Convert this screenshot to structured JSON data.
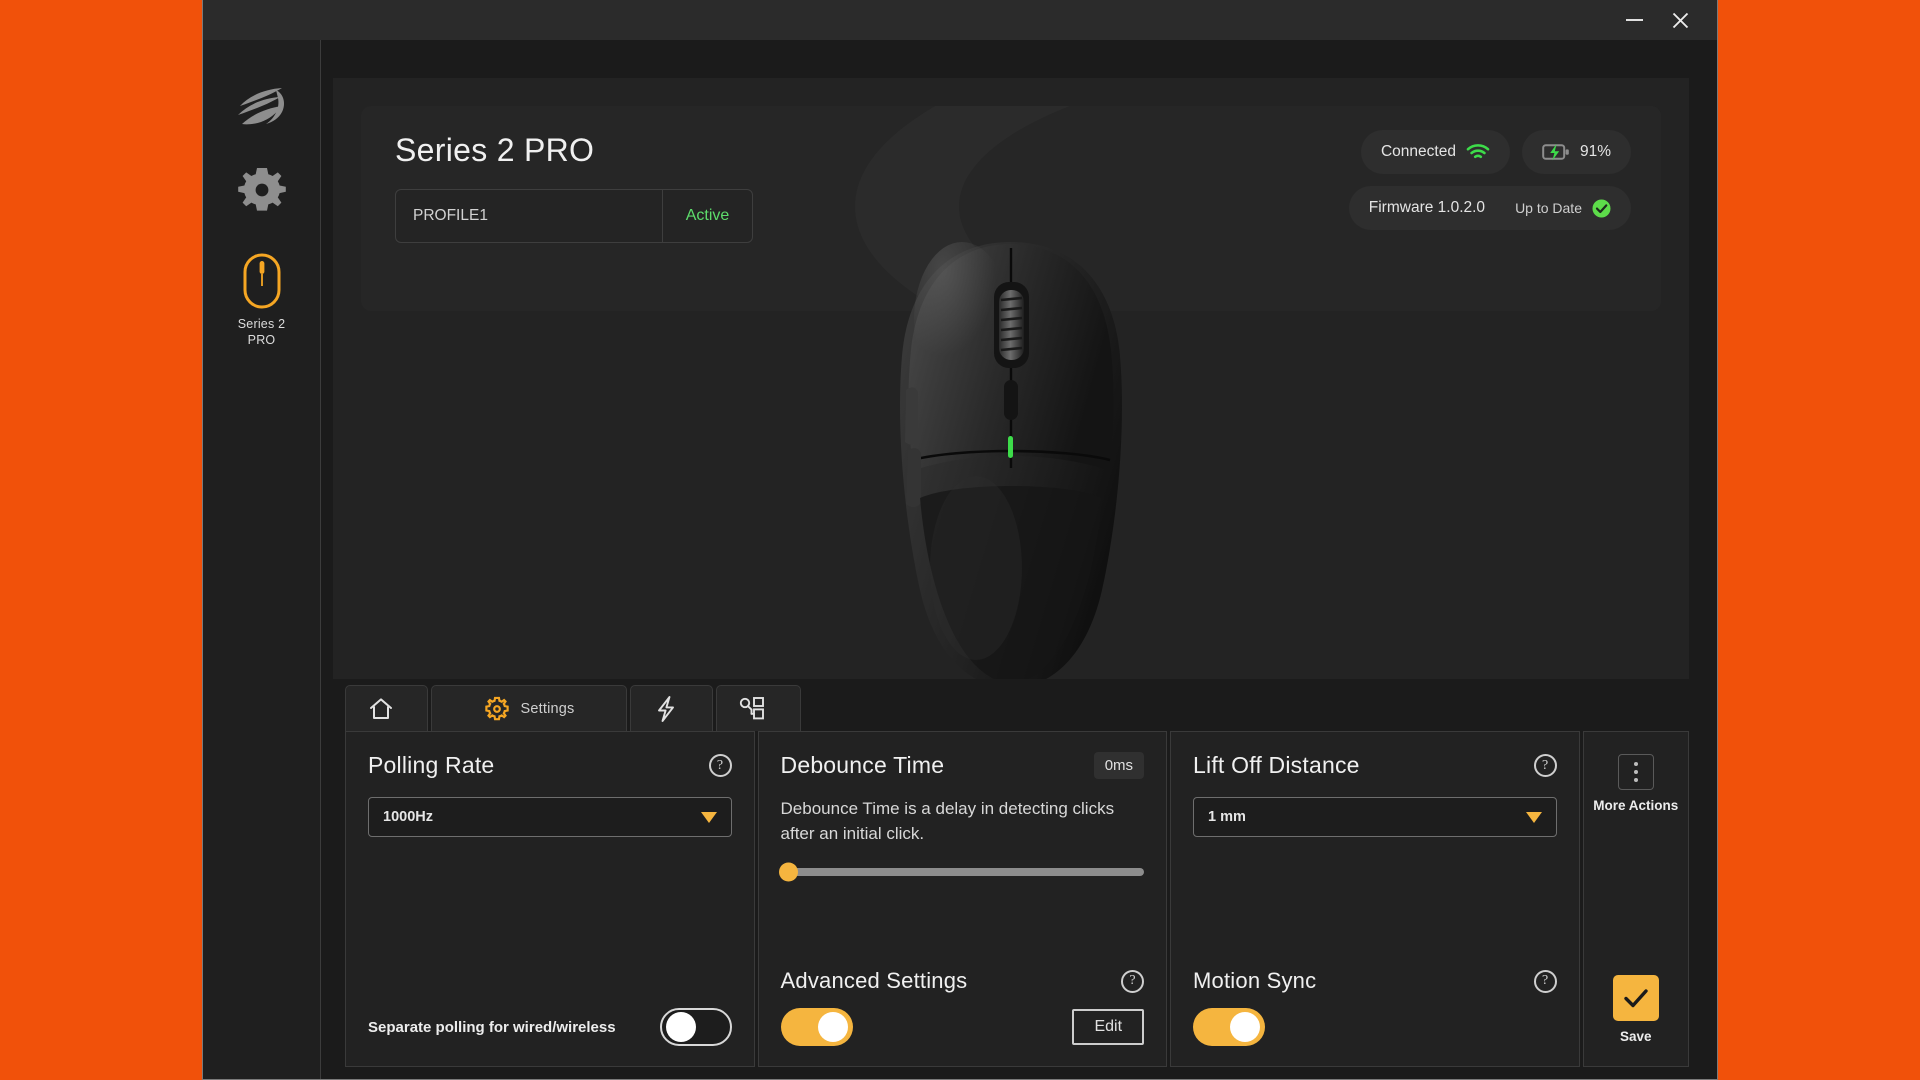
{
  "titlebar": {
    "minimize_label": "Minimize",
    "close_label": "Close"
  },
  "sidebar": {
    "items": [
      {
        "icon": "brand-logo-icon",
        "label": ""
      },
      {
        "icon": "gear-icon",
        "label": ""
      },
      {
        "icon": "mouse-icon",
        "label": "Series 2\nPRO",
        "label_line1": "Series 2",
        "label_line2": "PRO",
        "active": true
      }
    ]
  },
  "hero": {
    "device_title": "Series 2 PRO",
    "profile": {
      "name": "PROFILE1",
      "status": "Active"
    },
    "connection": {
      "label": "Connected",
      "icon": "wifi-icon",
      "color": "#3ddc4a"
    },
    "battery": {
      "value": "91%",
      "icon": "battery-charging-icon",
      "color": "#3ddc4a"
    },
    "firmware": {
      "label": "Firmware 1.0.2.0",
      "status": "Up to Date",
      "icon": "check-circle-icon",
      "color": "#5ddc4a"
    }
  },
  "tabs": [
    {
      "id": "home",
      "icon": "home-icon",
      "label": ""
    },
    {
      "id": "settings",
      "icon": "gear-icon",
      "label": "Settings",
      "active": true
    },
    {
      "id": "performance",
      "icon": "lightning-icon",
      "label": ""
    },
    {
      "id": "keybinds",
      "icon": "key-layout-icon",
      "label": ""
    }
  ],
  "panels": {
    "polling": {
      "title": "Polling Rate",
      "help_icon": "help-icon",
      "select_value": "1000Hz",
      "separate_polling_label": "Separate polling for wired/wireless",
      "separate_polling_state": "off"
    },
    "debounce": {
      "title": "Debounce Time",
      "value_chip": "0ms",
      "description": "Debounce Time is a delay in detecting clicks after an initial click.",
      "slider_percent": 0,
      "advanced": {
        "title": "Advanced Settings",
        "help_icon": "help-icon",
        "toggle_state": "on",
        "edit_label": "Edit"
      }
    },
    "lift_off": {
      "title": "Lift Off Distance",
      "help_icon": "help-icon",
      "select_value": "1 mm",
      "motion_sync": {
        "title": "Motion Sync",
        "help_icon": "help-icon",
        "toggle_state": "on"
      }
    },
    "actions": {
      "more_actions_label": "More Actions",
      "more_actions_icon": "kebab-menu-icon",
      "save_label": "Save",
      "save_icon": "check-icon"
    }
  },
  "theme": {
    "accent": "#F5B53F",
    "success": "#3ddc4a",
    "window_bg": "#1b1b1b",
    "desktop_bg": "#F1510A"
  }
}
